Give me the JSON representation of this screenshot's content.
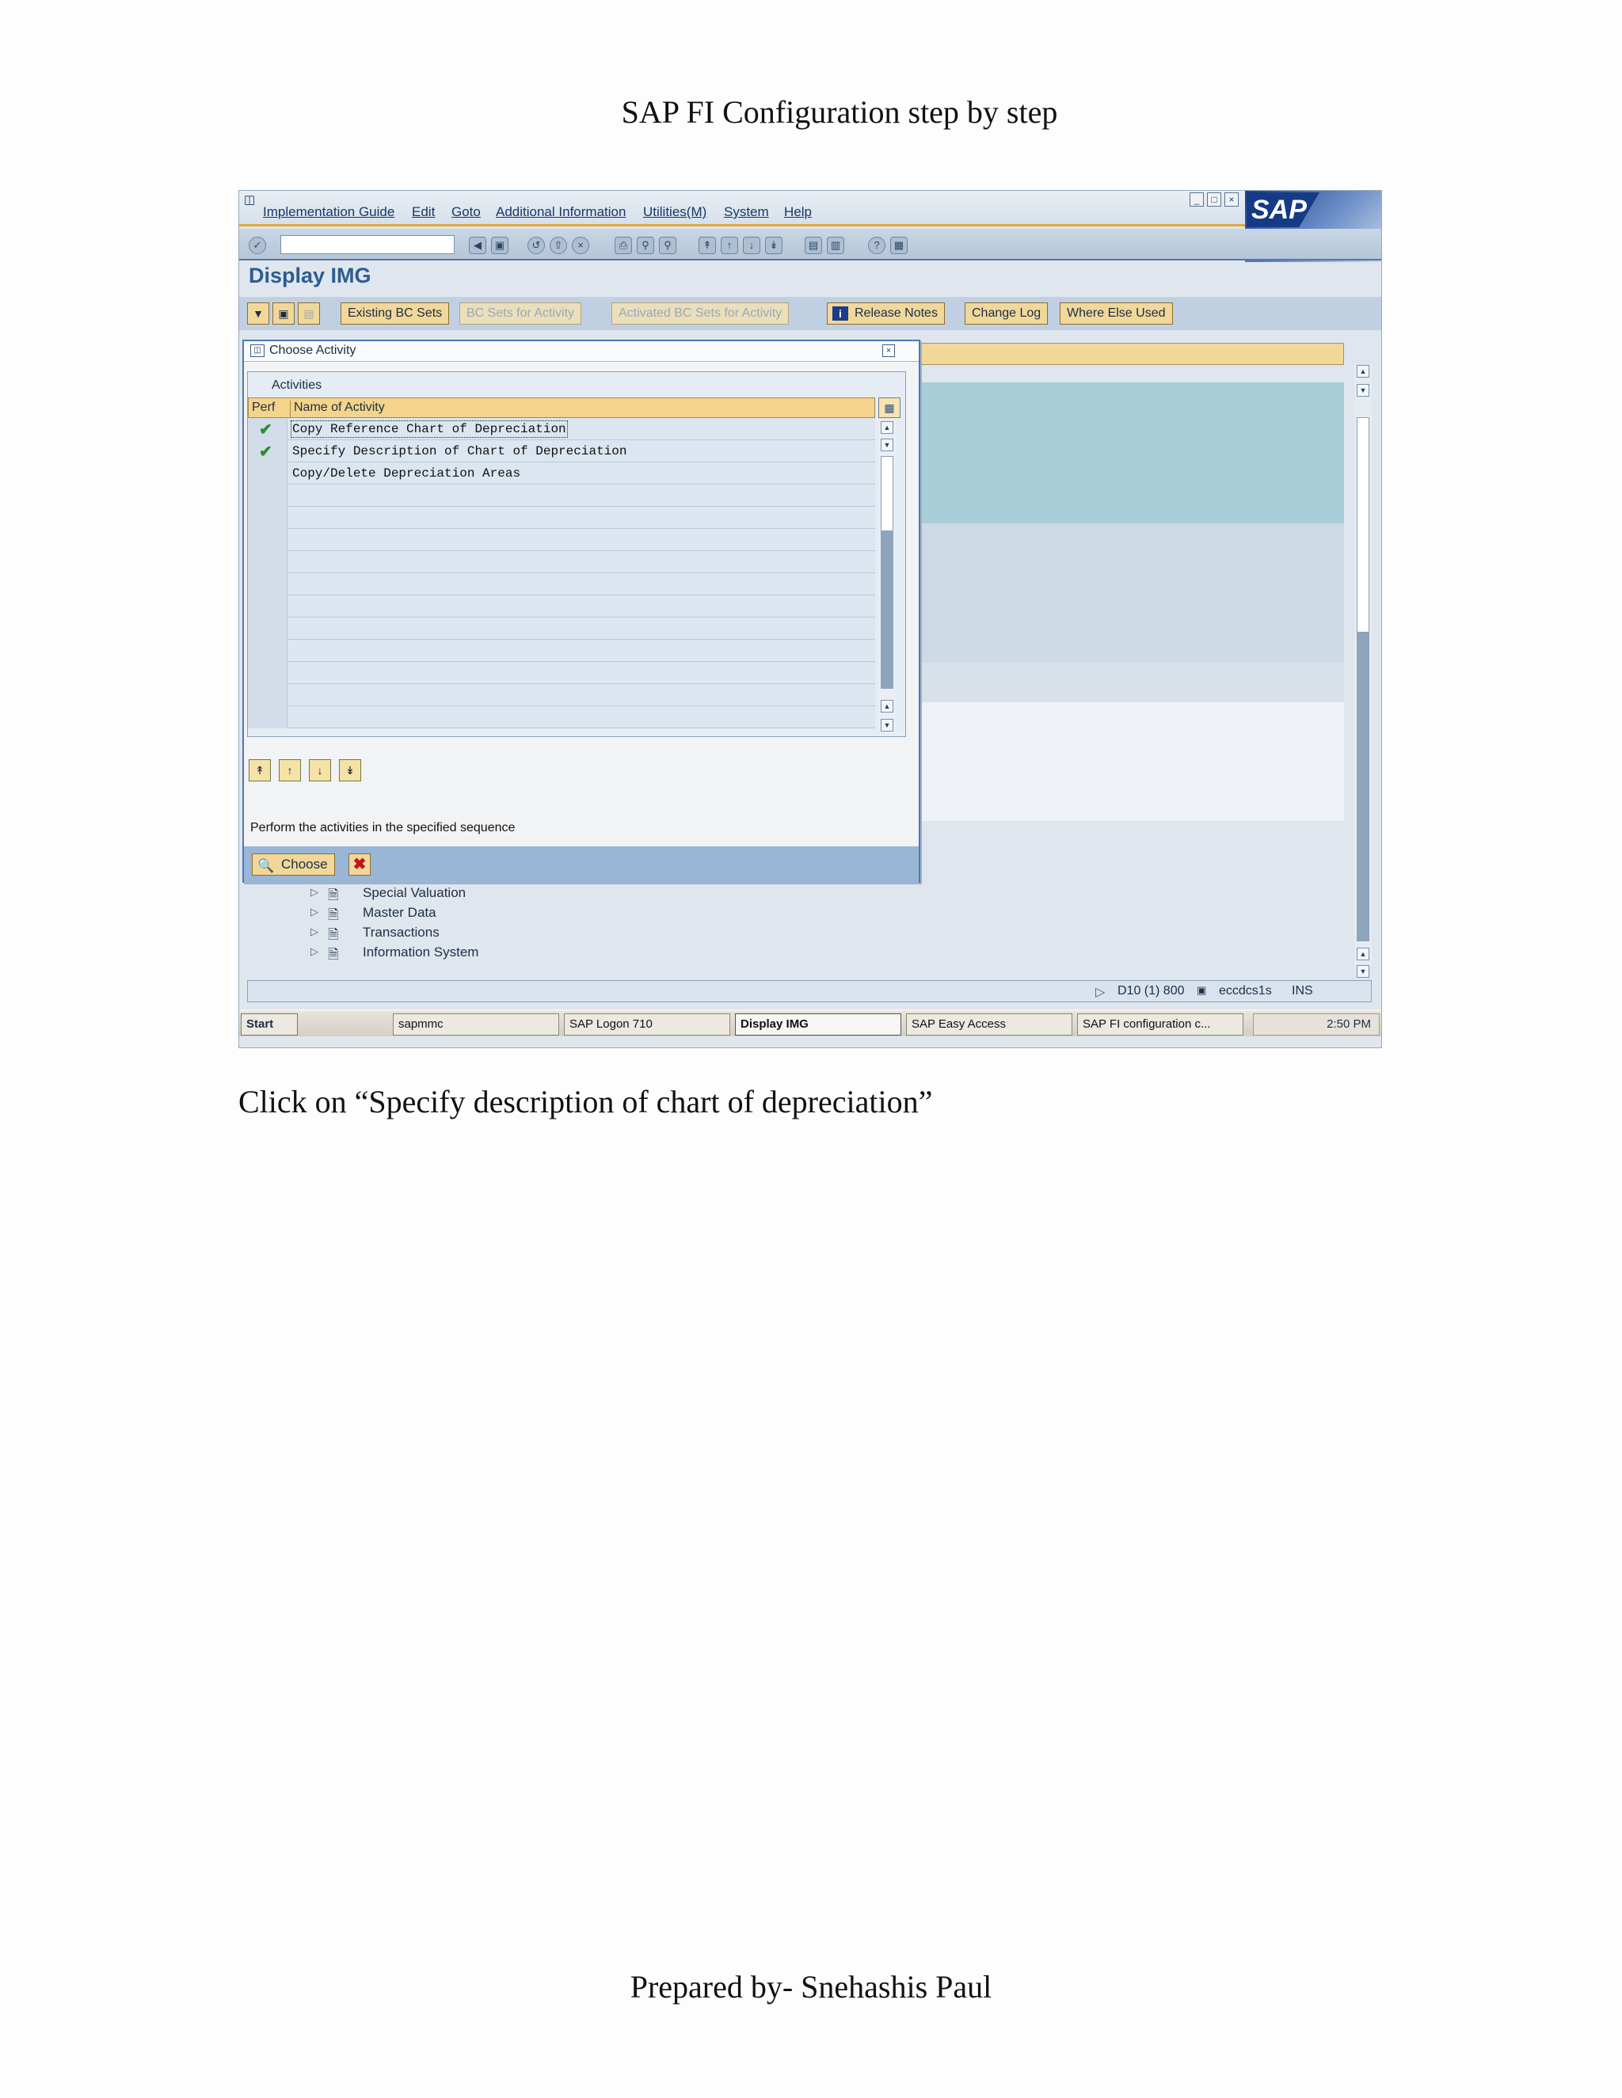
{
  "document": {
    "title": "SAP FI Configuration step by step",
    "instruction": "Click on “Specify description of chart of depreciation”",
    "footer": "Prepared by- Snehashis Paul"
  },
  "sap": {
    "menu": [
      "Implementation Guide",
      "Edit",
      "Goto",
      "Additional Information",
      "Utilities(M)",
      "System",
      "Help"
    ],
    "logo": "SAP",
    "screen_title": "Display IMG",
    "app_toolbar": {
      "existing_bc_sets": "Existing BC Sets",
      "bc_sets_for_activity": "BC Sets for Activity",
      "activated_bc_sets": "Activated BC Sets for Activity",
      "release_notes": "Release Notes",
      "change_log": "Change Log",
      "where_else_used": "Where Else Used"
    },
    "dialog": {
      "title": "Choose Activity",
      "caption": "Activities",
      "col_perf": "Perf",
      "col_name": "Name of Activity",
      "rows": [
        {
          "name": "Copy Reference Chart of Depreciation",
          "done": true
        },
        {
          "name": "Specify Description of Chart of Depreciation",
          "done": true
        },
        {
          "name": "Copy/Delete Depreciation Areas",
          "done": false
        }
      ],
      "hint": "Perform the activities in the specified sequence",
      "choose": "Choose"
    },
    "tree": [
      "Special Valuation",
      "Master Data",
      "Transactions",
      "Information System"
    ],
    "status": {
      "system": "D10 (1) 800",
      "server": "eccdcs1s",
      "mode": "INS"
    },
    "taskbar": {
      "start": "Start",
      "items": [
        "sapmmc",
        "SAP Logon 710",
        "Display IMG",
        "SAP Easy Access",
        "SAP FI configuration c..."
      ],
      "clock": "2:50 PM"
    },
    "colors": {
      "accent": "#f1d89a",
      "title": "#2d5c92",
      "check": "#2e8b2e"
    }
  }
}
